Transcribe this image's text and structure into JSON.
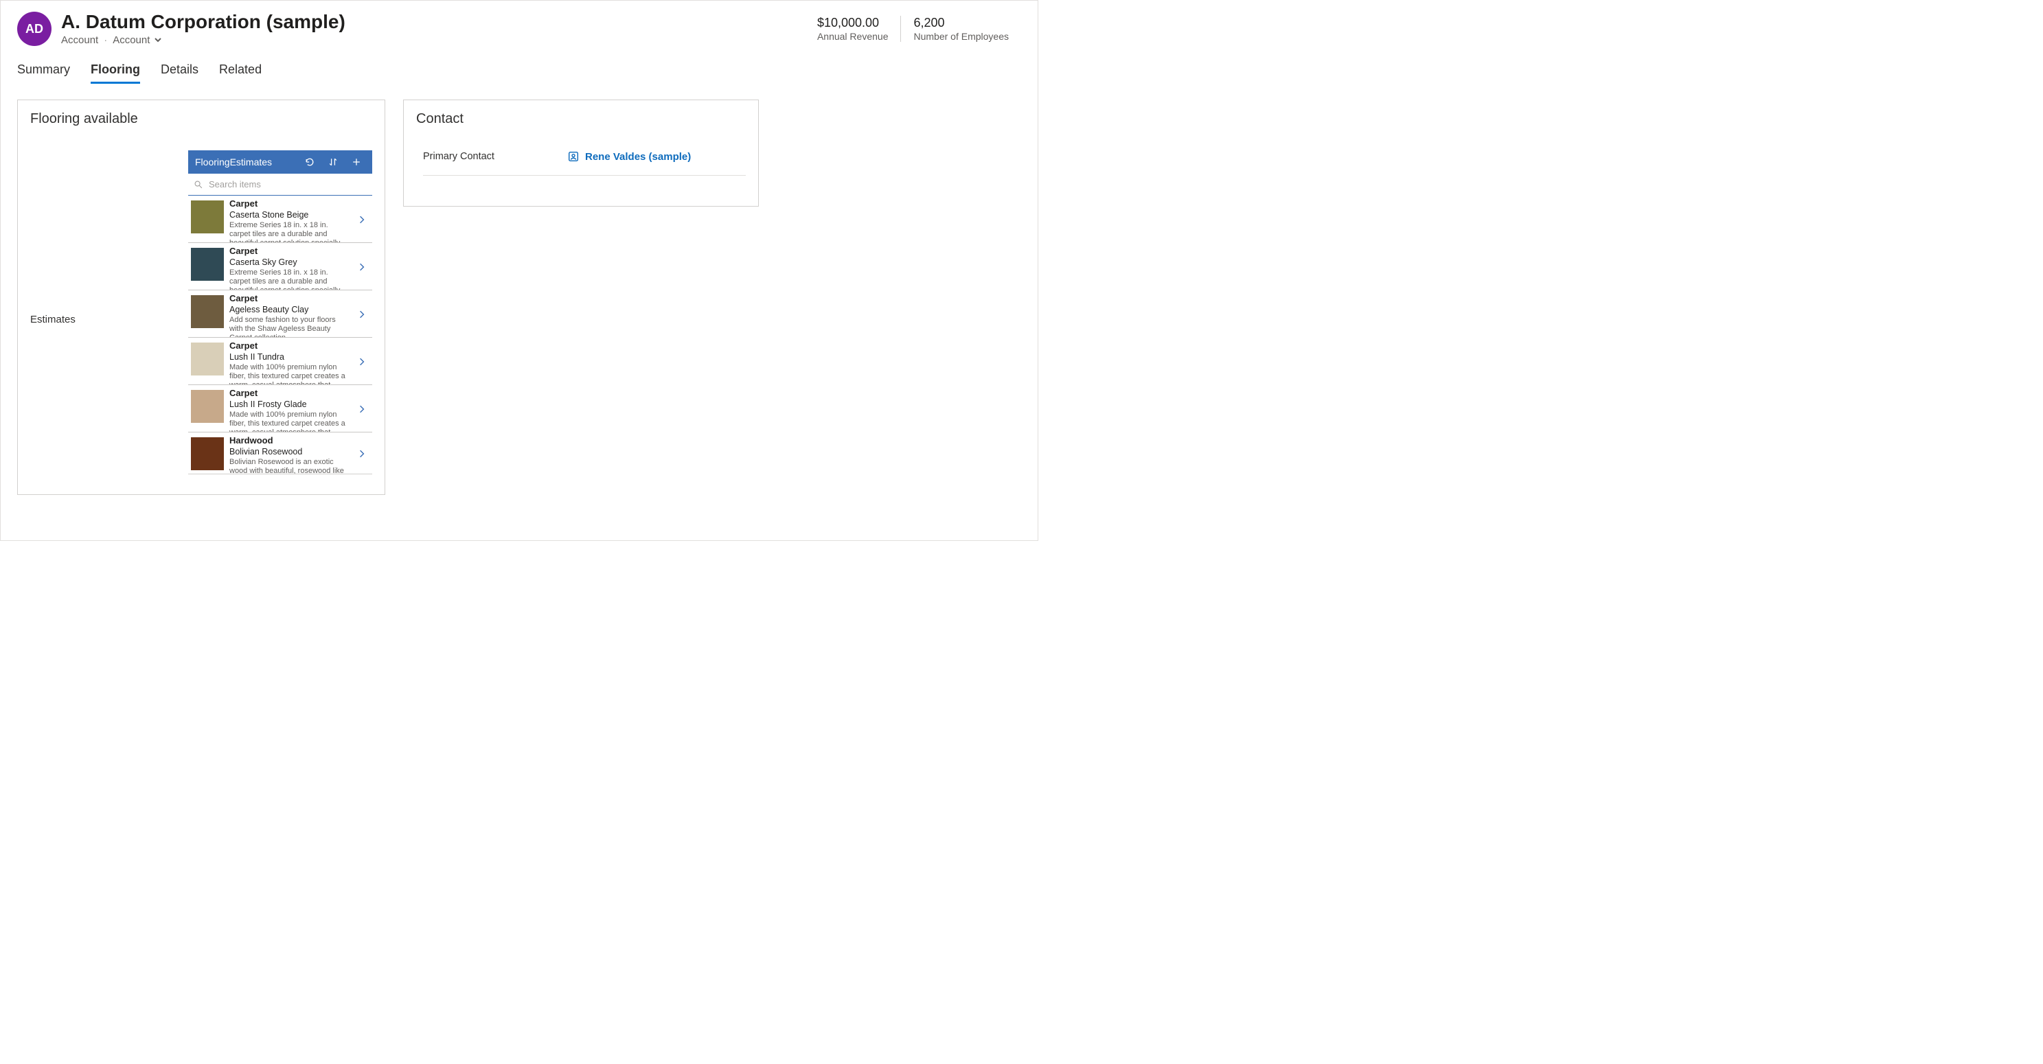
{
  "header": {
    "avatar_initials": "AD",
    "title": "A. Datum Corporation (sample)",
    "entity_type": "Account",
    "form_name": "Account",
    "stats": [
      {
        "value": "$10,000.00",
        "label": "Annual Revenue"
      },
      {
        "value": "6,200",
        "label": "Number of Employees"
      }
    ]
  },
  "tabs": [
    {
      "label": "Summary",
      "active": false
    },
    {
      "label": "Flooring",
      "active": true
    },
    {
      "label": "Details",
      "active": false
    },
    {
      "label": "Related",
      "active": false
    }
  ],
  "flooring": {
    "card_title": "Flooring available",
    "estimates_label": "Estimates",
    "list_title": "FlooringEstimates",
    "search_placeholder": "Search items",
    "items": [
      {
        "category": "Carpet",
        "name": "Caserta Stone Beige",
        "desc": "Extreme Series 18 in. x 18 in. carpet tiles are a durable and beautiful carpet solution specially engineered for both",
        "swatch": "#7d7a3a"
      },
      {
        "category": "Carpet",
        "name": "Caserta Sky Grey",
        "desc": "Extreme Series 18 in. x 18 in. carpet tiles are a durable and beautiful carpet solution specially engineered for both",
        "swatch": "#2f4a55"
      },
      {
        "category": "Carpet",
        "name": "Ageless Beauty Clay",
        "desc": "Add some fashion to your floors with the Shaw Ageless Beauty Carpet collection.",
        "swatch": "#6e5c3f"
      },
      {
        "category": "Carpet",
        "name": "Lush II Tundra",
        "desc": "Made with 100% premium nylon fiber, this textured carpet creates a warm, casual atmosphere that invites you to",
        "swatch": "#d9cfb8"
      },
      {
        "category": "Carpet",
        "name": "Lush II Frosty Glade",
        "desc": "Made with 100% premium nylon fiber, this textured carpet creates a warm, casual atmosphere that invites you to",
        "swatch": "#c7a98a"
      },
      {
        "category": "Hardwood",
        "name": "Bolivian Rosewood",
        "desc": "Bolivian Rosewood is an exotic wood with beautiful, rosewood like wood with",
        "swatch": "#6a3317"
      }
    ]
  },
  "contact": {
    "card_title": "Contact",
    "label": "Primary Contact",
    "value": "Rene Valdes (sample)"
  }
}
